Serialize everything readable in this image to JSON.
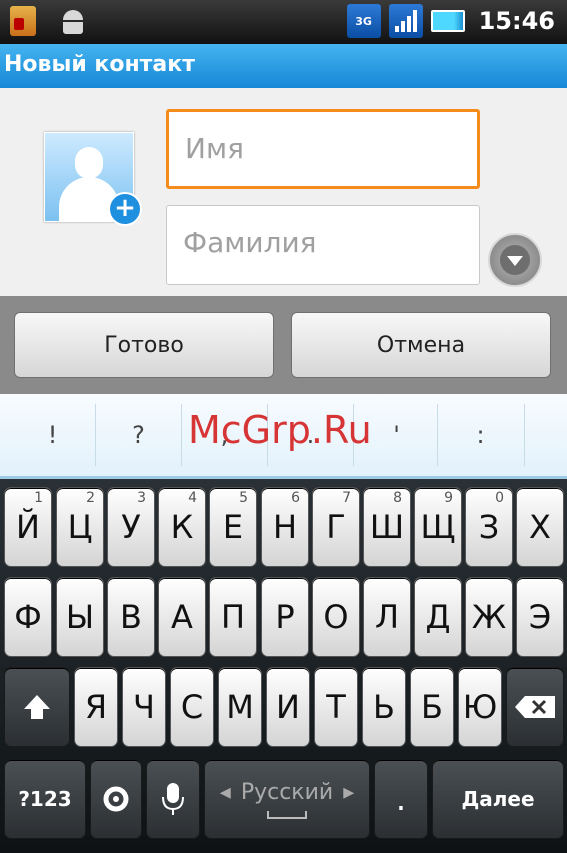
{
  "status_bar": {
    "network": "3G",
    "time": "15:46"
  },
  "title": "Новый контакт",
  "form": {
    "first_name_placeholder": "Имя",
    "last_name_placeholder": "Фамилия"
  },
  "buttons": {
    "done": "Готово",
    "cancel": "Отмена"
  },
  "suggestions": [
    "!",
    "?",
    ",",
    ".",
    "'",
    ":"
  ],
  "watermark": "McGrp.Ru",
  "keyboard": {
    "row1": [
      {
        "label": "Й",
        "num": "1"
      },
      {
        "label": "Ц",
        "num": "2"
      },
      {
        "label": "У",
        "num": "3"
      },
      {
        "label": "К",
        "num": "4"
      },
      {
        "label": "Е",
        "num": "5"
      },
      {
        "label": "Н",
        "num": "6"
      },
      {
        "label": "Г",
        "num": "7"
      },
      {
        "label": "Ш",
        "num": "8"
      },
      {
        "label": "Щ",
        "num": "9"
      },
      {
        "label": "З",
        "num": "0"
      },
      {
        "label": "Х",
        "num": ""
      }
    ],
    "row2": [
      "Ф",
      "Ы",
      "В",
      "А",
      "П",
      "Р",
      "О",
      "Л",
      "Д",
      "Ж",
      "Э"
    ],
    "row3": [
      "Я",
      "Ч",
      "С",
      "М",
      "И",
      "Т",
      "Ь",
      "Б",
      "Ю"
    ],
    "symbols_key": "?123",
    "language": "Русский",
    "period": ".",
    "next_key": "Далее"
  },
  "colors": {
    "title_bar": "#1688d6",
    "focus_border": "#f48b1a",
    "watermark": "#d42020"
  }
}
